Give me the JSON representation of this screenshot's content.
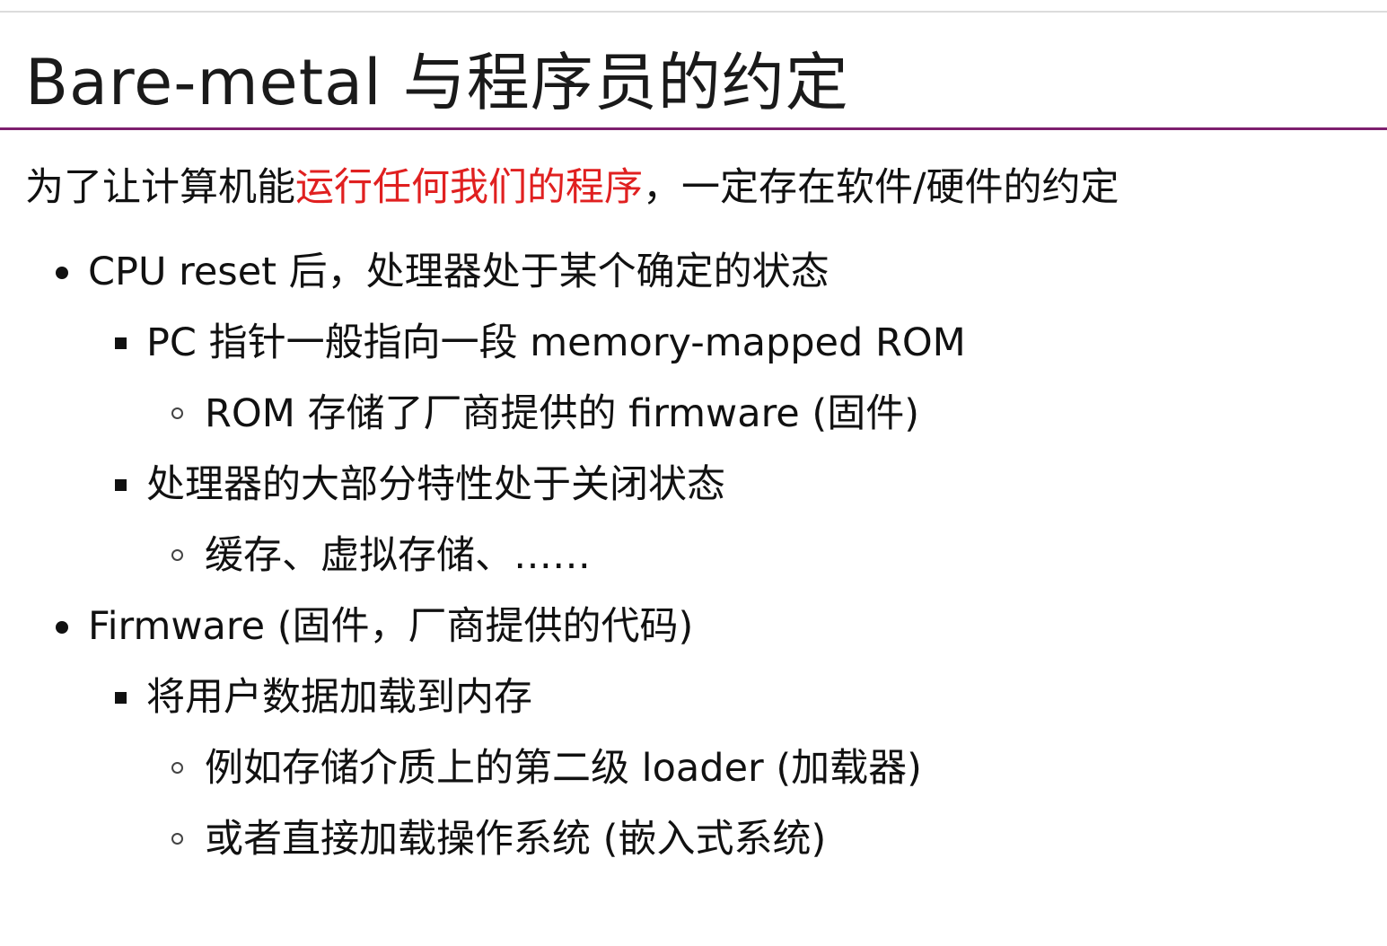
{
  "slide": {
    "title": "Bare-metal 与程序员的约定",
    "intro": {
      "before": "为了让计算机能",
      "highlight": "运行任何我们的程序",
      "after": "，一定存在软件/硬件的约定"
    },
    "bullets": [
      {
        "level": 1,
        "text": "CPU reset 后，处理器处于某个确定的状态"
      },
      {
        "level": 2,
        "text": "PC 指针一般指向一段 memory-mapped ROM"
      },
      {
        "level": 3,
        "text": "ROM 存储了厂商提供的 firmware (固件)"
      },
      {
        "level": 2,
        "text": "处理器的大部分特性处于关闭状态"
      },
      {
        "level": 3,
        "text": "缓存、虚拟存储、……"
      },
      {
        "level": 1,
        "text": "Firmware (固件，厂商提供的代码)"
      },
      {
        "level": 2,
        "text": "将用户数据加载到内存"
      },
      {
        "level": 3,
        "text": "例如存储介质上的第二级 loader (加载器)"
      },
      {
        "level": 3,
        "text": "或者直接加载操作系统 (嵌入式系统)"
      }
    ]
  },
  "colors": {
    "highlight": "#e02020",
    "title_rule": "#7d1f6e",
    "text": "#111111"
  }
}
